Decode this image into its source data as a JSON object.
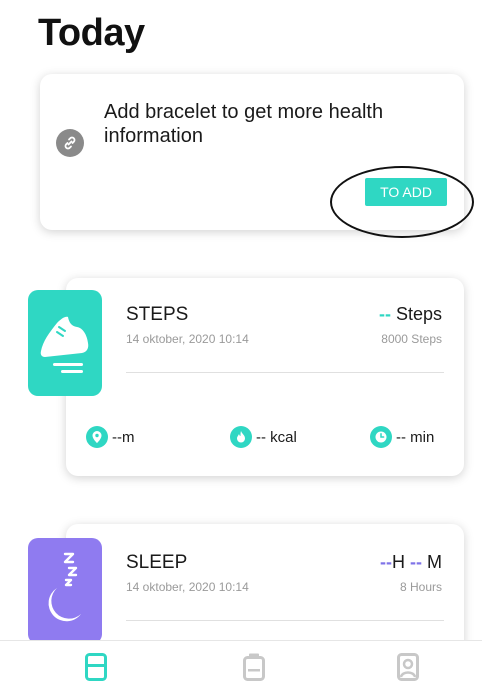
{
  "page": {
    "title": "Today"
  },
  "bracelet": {
    "message": "Add bracelet to get more health information",
    "button_label": "TO ADD",
    "icon": "link-icon"
  },
  "steps": {
    "title": "STEPS",
    "timestamp": "14 oktober, 2020 10:14",
    "value_dash": "--",
    "value_unit": "Steps",
    "goal": "8000 Steps",
    "distance": "--m",
    "calories": "-- kcal",
    "duration": "-- min",
    "icons": [
      "shoe-icon",
      "location-pin-icon",
      "flame-icon",
      "clock-icon"
    ]
  },
  "sleep": {
    "title": "SLEEP",
    "timestamp": "14 oktober, 2020 10:14",
    "hours_dash": "--",
    "hours_unit": "H",
    "minutes_dash": "--",
    "minutes_unit": "M",
    "goal": "8 Hours",
    "icons": [
      "moon-zzz-icon"
    ]
  },
  "nav": {
    "items": [
      "today-tab-icon",
      "device-tab-icon",
      "profile-tab-icon"
    ],
    "active_index": 0
  },
  "colors": {
    "accent": "#2fd7c3",
    "sleep": "#8f7bf0",
    "nav_active": "#2fd7c3",
    "nav_inactive": "#c8c8c8"
  }
}
